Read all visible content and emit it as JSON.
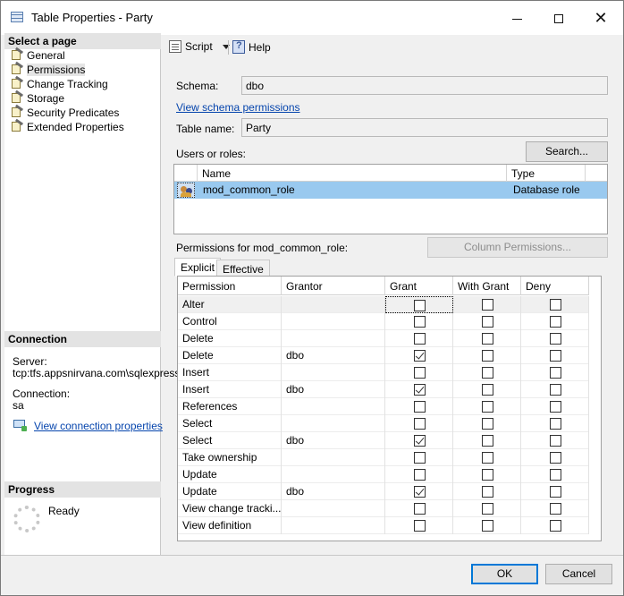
{
  "window": {
    "title": "Table Properties - Party"
  },
  "left": {
    "select_page_header": "Select a page",
    "pages": [
      {
        "label": "General"
      },
      {
        "label": "Permissions"
      },
      {
        "label": "Change Tracking"
      },
      {
        "label": "Storage"
      },
      {
        "label": "Security Predicates"
      },
      {
        "label": "Extended Properties"
      }
    ],
    "connection_header": "Connection",
    "server_label": "Server:",
    "server_value": "tcp:tfs.appsnirvana.com\\sqlexpress",
    "connection_label": "Connection:",
    "connection_value": "sa",
    "view_connection_link": "View connection properties",
    "progress_header": "Progress",
    "progress_status": "Ready"
  },
  "toolbar": {
    "script_label": "Script",
    "help_label": "Help"
  },
  "form": {
    "schema_label": "Schema:",
    "schema_value": "dbo",
    "view_schema_link": "View schema permissions",
    "table_name_label": "Table name:",
    "table_name_value": "Party",
    "users_roles_label": "Users or roles:",
    "search_button": "Search...",
    "users_columns": [
      "Name",
      "Type"
    ],
    "users": [
      {
        "name": "mod_common_role",
        "type": "Database role"
      }
    ],
    "permissions_for_label": "Permissions for mod_common_role:",
    "column_permissions_button": "Column Permissions...",
    "tabs": [
      "Explicit",
      "Effective"
    ],
    "perm_columns": [
      "Permission",
      "Grantor",
      "Grant",
      "With Grant",
      "Deny"
    ],
    "permissions": [
      {
        "permission": "Alter",
        "grantor": "",
        "grant": false,
        "with_grant": false,
        "deny": false
      },
      {
        "permission": "Control",
        "grantor": "",
        "grant": false,
        "with_grant": false,
        "deny": false
      },
      {
        "permission": "Delete",
        "grantor": "",
        "grant": false,
        "with_grant": false,
        "deny": false
      },
      {
        "permission": "Delete",
        "grantor": "dbo",
        "grant": true,
        "with_grant": false,
        "deny": false
      },
      {
        "permission": "Insert",
        "grantor": "",
        "grant": false,
        "with_grant": false,
        "deny": false
      },
      {
        "permission": "Insert",
        "grantor": "dbo",
        "grant": true,
        "with_grant": false,
        "deny": false
      },
      {
        "permission": "References",
        "grantor": "",
        "grant": false,
        "with_grant": false,
        "deny": false
      },
      {
        "permission": "Select",
        "grantor": "",
        "grant": false,
        "with_grant": false,
        "deny": false
      },
      {
        "permission": "Select",
        "grantor": "dbo",
        "grant": true,
        "with_grant": false,
        "deny": false
      },
      {
        "permission": "Take ownership",
        "grantor": "",
        "grant": false,
        "with_grant": false,
        "deny": false
      },
      {
        "permission": "Update",
        "grantor": "",
        "grant": false,
        "with_grant": false,
        "deny": false
      },
      {
        "permission": "Update",
        "grantor": "dbo",
        "grant": true,
        "with_grant": false,
        "deny": false
      },
      {
        "permission": "View change tracki...",
        "grantor": "",
        "grant": false,
        "with_grant": false,
        "deny": false
      },
      {
        "permission": "View definition",
        "grantor": "",
        "grant": false,
        "with_grant": false,
        "deny": false
      }
    ]
  },
  "buttons": {
    "ok": "OK",
    "cancel": "Cancel"
  }
}
